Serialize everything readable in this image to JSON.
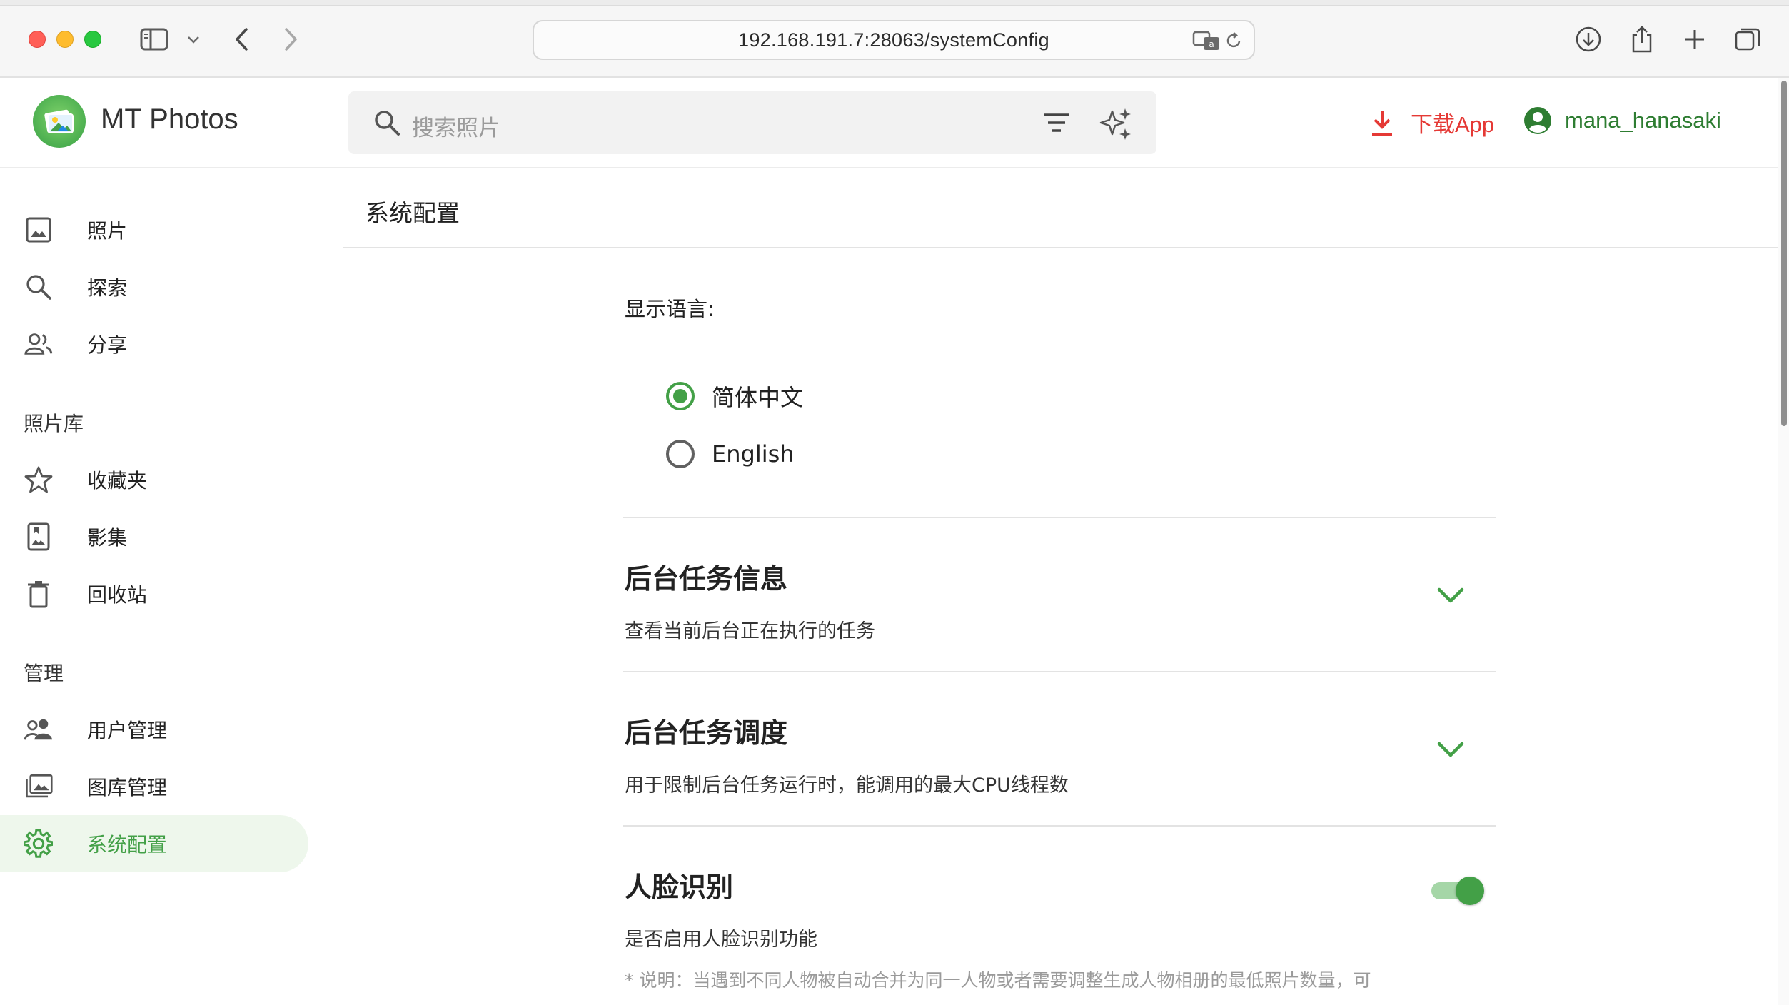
{
  "browser": {
    "url": "192.168.191.7:28063/systemConfig"
  },
  "header": {
    "app_title": "MT Photos",
    "search_placeholder": "搜索照片",
    "download_label": "下载App",
    "username": "mana_hanasaki"
  },
  "sidebar": {
    "items": [
      {
        "label": "照片",
        "icon": "image-icon"
      },
      {
        "label": "探索",
        "icon": "search-icon"
      },
      {
        "label": "分享",
        "icon": "people-icon"
      }
    ],
    "library_title": "照片库",
    "library_items": [
      {
        "label": "收藏夹",
        "icon": "star-icon"
      },
      {
        "label": "影集",
        "icon": "album-icon"
      },
      {
        "label": "回收站",
        "icon": "trash-icon"
      }
    ],
    "admin_title": "管理",
    "admin_items": [
      {
        "label": "用户管理",
        "icon": "users-icon"
      },
      {
        "label": "图库管理",
        "icon": "gallery-icon"
      },
      {
        "label": "系统配置",
        "icon": "gear-icon",
        "active": true
      }
    ]
  },
  "page": {
    "title": "系统配置",
    "language": {
      "label": "显示语言:",
      "options": [
        {
          "label": "简体中文",
          "selected": true
        },
        {
          "label": "English",
          "selected": false
        }
      ]
    },
    "sections": [
      {
        "title": "后台任务信息",
        "desc": "查看当前后台正在执行的任务"
      },
      {
        "title": "后台任务调度",
        "desc": "用于限制后台任务运行时，能调用的最大CPU线程数"
      },
      {
        "title": "人脸识别",
        "desc": "是否启用人脸识别功能",
        "enabled": true,
        "note": "* 说明：当遇到不同人物被自动合并为同一人物或者需要调整生成人物相册的最低照片数量，可"
      }
    ]
  },
  "colors": {
    "accent": "#43a047",
    "accent_light": "#eef7ec",
    "danger": "#e53935"
  }
}
